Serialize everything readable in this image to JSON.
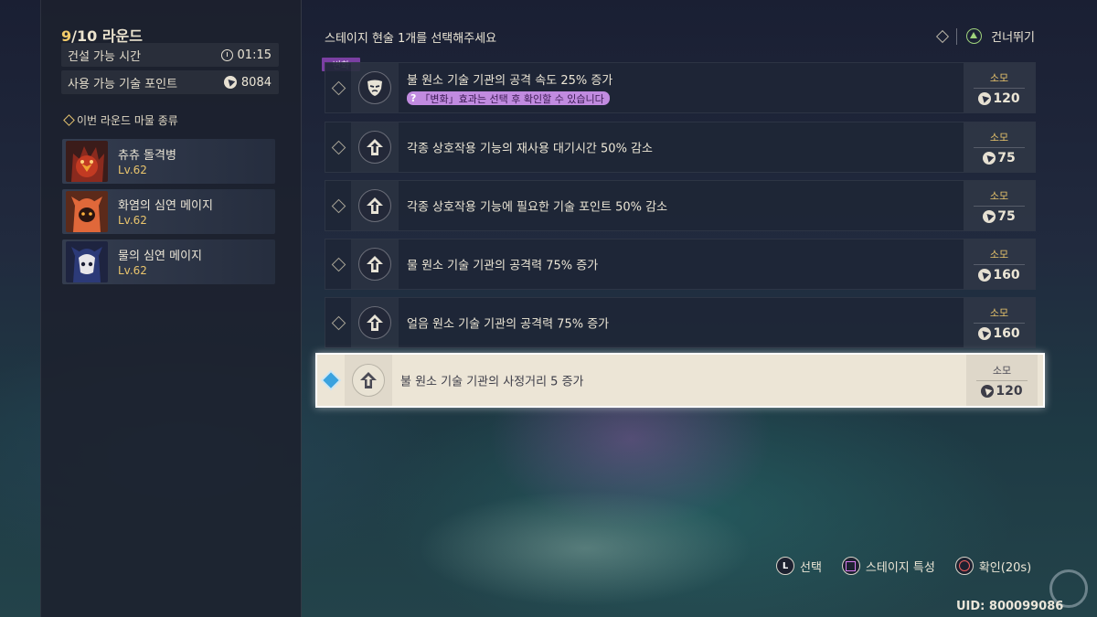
{
  "round": {
    "current": "9",
    "rest": "/10 라운드"
  },
  "stats": [
    {
      "label": "건설 가능 시간",
      "value": "01:15",
      "icon": "clock-icon"
    },
    {
      "label": "사용 가능 기술 포인트",
      "value": "8084",
      "icon": "point-icon"
    }
  ],
  "monsters": {
    "header": "이번 라운드 마물 종류",
    "items": [
      {
        "name": "츄츄 돌격병",
        "level": "Lv.62"
      },
      {
        "name": "화염의 심연 메이지",
        "level": "Lv.62"
      },
      {
        "name": "물의 심연 메이지",
        "level": "Lv.62"
      }
    ]
  },
  "instruction": "스테이지 현술 1개를 선택해주세요",
  "skip_label": "건너뛰기",
  "change_tag": "변화",
  "hint": {
    "mark": "?",
    "text": "「변화」효과는 선택 후 확인할 수 있습니다"
  },
  "cost_label": "소모",
  "options": [
    {
      "text": "불 원소 기술 기관의 공격 속도 25% 증가",
      "cost": "120",
      "icon": "mask-icon"
    },
    {
      "text": "각종 상호작용 기능의 재사용 대기시간 50% 감소",
      "cost": "75",
      "icon": "up-arrow-icon"
    },
    {
      "text": "각종 상호작용 기능에 필요한 기술 포인트 50% 감소",
      "cost": "75",
      "icon": "up-arrow-icon"
    },
    {
      "text": "물 원소 기술 기관의 공격력 75% 증가",
      "cost": "160",
      "icon": "up-arrow-icon"
    },
    {
      "text": "얼음 원소 기술 기관의 공격력 75% 증가",
      "cost": "160",
      "icon": "up-arrow-icon"
    },
    {
      "text": "불 원소 기술 기관의 사정거리 5 증가",
      "cost": "120",
      "icon": "up-arrow-icon"
    }
  ],
  "controls": [
    {
      "label": "선택",
      "button": "L"
    },
    {
      "label": "스테이지 특성",
      "button": "square"
    },
    {
      "label": "확인(20s)",
      "button": "circle"
    }
  ],
  "uid": "UID: 800099086",
  "colors": {
    "accent_gold": "#f2cb6a",
    "change_purple": "#7b3fa3",
    "hint_purple": "#c18be0",
    "selected_blue": "#3aa2de"
  }
}
